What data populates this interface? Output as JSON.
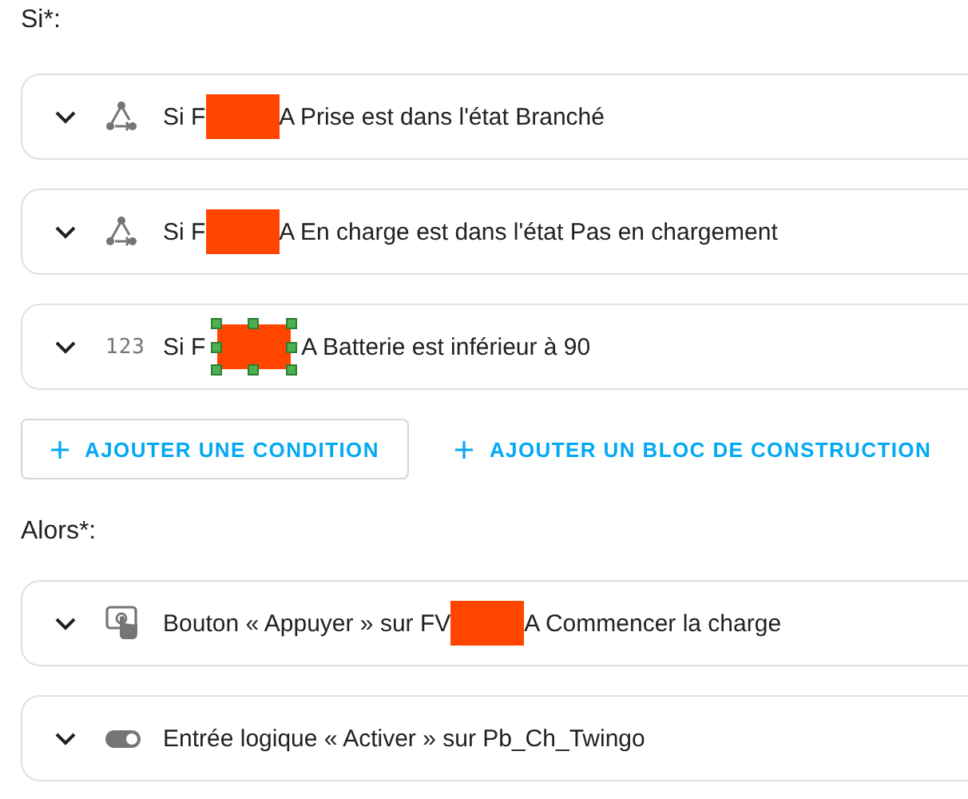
{
  "if_section": {
    "label": "Si*:",
    "items": [
      {
        "kind": "state",
        "text_before": "Si F",
        "redaction": {
          "selected": false
        },
        "text_after": "A Prise est dans l'état Branché"
      },
      {
        "kind": "state",
        "text_before": "Si F",
        "redaction": {
          "selected": false
        },
        "text_after": "A En charge est dans l'état Pas en chargement"
      },
      {
        "kind": "numeric",
        "icon_text": "123",
        "text_before": "Si F",
        "redaction": {
          "selected": true
        },
        "text_after": "A Batterie est inférieur à 90"
      }
    ],
    "buttons": [
      {
        "label": "AJOUTER UNE CONDITION",
        "outlined": true
      },
      {
        "label": "AJOUTER UN BLOC DE CONSTRUCTION",
        "outlined": false
      }
    ]
  },
  "then_section": {
    "label": "Alors*:",
    "items": [
      {
        "kind": "button",
        "text_before": "Bouton « Appuyer » sur FV",
        "redaction": {
          "selected": false
        },
        "text_after": "A Commencer la charge"
      },
      {
        "kind": "toggle",
        "text_before": "Entrée logique « Activer » sur Pb_Ch_Twingo"
      }
    ]
  }
}
